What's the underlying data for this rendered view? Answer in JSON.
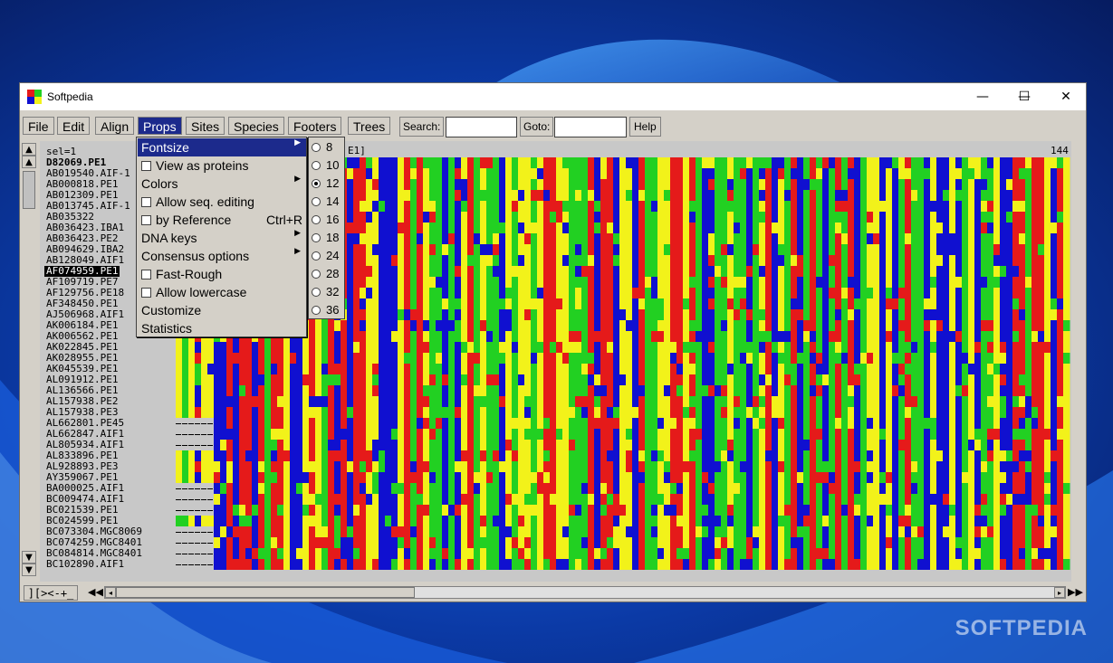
{
  "window": {
    "title": "Softpedia"
  },
  "title_controls": {
    "minimize": "—",
    "maximize": "☐",
    "close": "✕"
  },
  "menubar": {
    "items": [
      "File",
      "Edit",
      "Align",
      "Props",
      "Sites",
      "Species",
      "Footers",
      "Trees"
    ],
    "active": "Props",
    "search_label": "Search:",
    "search_value": "",
    "goto_label": "Goto:",
    "goto_value": "",
    "help_label": "Help"
  },
  "vertical_scroll": {
    "up": "▲",
    "down": "▼"
  },
  "alignment_header": {
    "sel_label": "sel=1",
    "start_text": "E1]",
    "end_position": "144"
  },
  "sequences": [
    "D82069.PE1",
    "AB019540.AIF-1",
    "AB000818.PE1",
    "AB012309.PE1",
    "AB013745.AIF-1",
    "AB035322",
    "AB036423.IBA1",
    "AB036423.PE2",
    "AB094629.IBA2",
    "AB128049.AIF1",
    "AF074959.PE1",
    "AF109719.PE7",
    "AF129756.PE18",
    "AF348450.PE1",
    "AJ506968.AIF1",
    "AK006184.PE1",
    "AK006562.PE1",
    "AK022845.PE1",
    "AK028955.PE1",
    "AK045539.PE1",
    "AL091912.PE1",
    "AL136566.PE1",
    "AL157938.PE2",
    "AL157938.PE3",
    "AL662801.PE45",
    "AL662847.AIF1",
    "AL805934.AIF1",
    "AL833896.PE1",
    "AL928893.PE3",
    "AY359067.PE1",
    "BA000025.AIF1",
    "BC009474.AIF1",
    "BC021539.PE1",
    "BC024599.PE1",
    "BC073304.MGC8069",
    "BC074259.MGC8401",
    "BC084814.MGC8401",
    "BC102890.AIF1"
  ],
  "selected_sequence": "AF074959.PE1",
  "bold_sequence": "D82069.PE1",
  "nucleotide_colors": {
    "A": "#e51a1a",
    "C": "#22d022",
    "G": "#f2f21a",
    "T": "#1010d0"
  },
  "props_menu": {
    "items": [
      {
        "label": "Fontsize",
        "type": "submenu",
        "highlighted": true
      },
      {
        "label": "View as proteins",
        "type": "checkbox",
        "checked": false
      },
      {
        "label": "Colors",
        "type": "submenu"
      },
      {
        "label": "Allow seq. editing",
        "type": "checkbox",
        "checked": false
      },
      {
        "label": "by Reference",
        "type": "checkbox",
        "checked": false,
        "shortcut": "Ctrl+R"
      },
      {
        "label": "DNA keys",
        "type": "submenu"
      },
      {
        "label": "Consensus options",
        "type": "submenu"
      },
      {
        "label": "Fast-Rough",
        "type": "checkbox",
        "checked": false
      },
      {
        "label": "Allow lowercase",
        "type": "checkbox",
        "checked": false
      },
      {
        "label": "Customize",
        "type": "item"
      },
      {
        "label": "Statistics",
        "type": "item"
      }
    ]
  },
  "fontsize_submenu": {
    "options": [
      "8",
      "10",
      "12",
      "14",
      "16",
      "18",
      "24",
      "28",
      "32",
      "36"
    ],
    "selected": "12"
  },
  "bottom_bar": {
    "mode_label": "][><-+_",
    "left_fast": "◀◀",
    "right_fast": "▶▶",
    "left": "◂",
    "right": "▸"
  },
  "watermark": "SOFTPEDIA"
}
